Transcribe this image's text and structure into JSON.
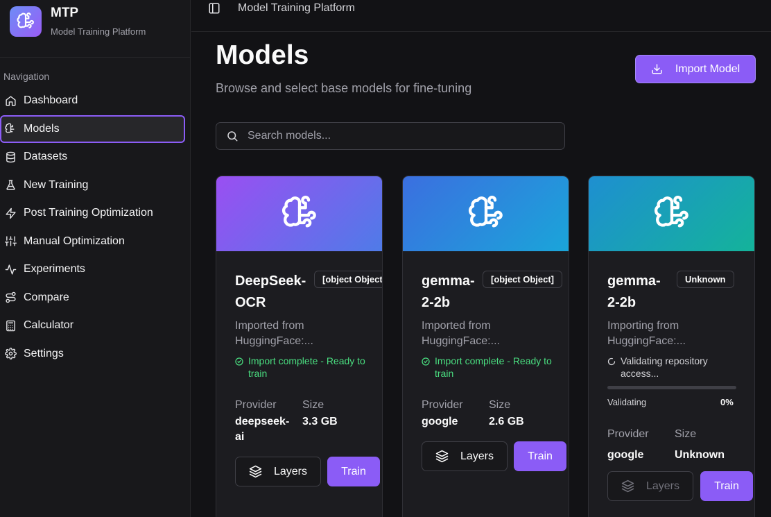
{
  "brand": {
    "name": "MTP",
    "subtitle": "Model Training Platform"
  },
  "sidebar": {
    "heading": "Navigation",
    "items": [
      {
        "label": "Dashboard",
        "icon": "home-icon"
      },
      {
        "label": "Models",
        "icon": "brain-icon",
        "active": true
      },
      {
        "label": "Datasets",
        "icon": "database-icon"
      },
      {
        "label": "New Training",
        "icon": "flask-icon"
      },
      {
        "label": "Post Training Optimization",
        "icon": "zap-icon"
      },
      {
        "label": "Manual Optimization",
        "icon": "sliders-icon"
      },
      {
        "label": "Experiments",
        "icon": "activity-icon"
      },
      {
        "label": "Compare",
        "icon": "route-icon"
      },
      {
        "label": "Calculator",
        "icon": "calculator-icon"
      },
      {
        "label": "Settings",
        "icon": "gear-icon"
      }
    ]
  },
  "topbar": {
    "title": "Model Training Platform"
  },
  "page": {
    "title": "Models",
    "subtitle": "Browse and select base models for fine-tuning",
    "import_label": "Import Model",
    "search_placeholder": "Search models..."
  },
  "colors": {
    "accent": "#8b5cf6",
    "success": "#4ade80",
    "background": "#121215"
  },
  "cards": [
    {
      "name": "DeepSeek-OCR",
      "badge": "[object Object]",
      "description": "Imported from HuggingFace:...",
      "status": "Import complete - Ready to train",
      "provider_label": "Provider",
      "provider": "deepseek-ai",
      "size_label": "Size",
      "size": "3.3 GB",
      "layers_label": "Layers",
      "train_label": "Train"
    },
    {
      "name": "gemma-2-2b",
      "badge": "[object Object]",
      "description": "Imported from HuggingFace:...",
      "status": "Import complete - Ready to train",
      "provider_label": "Provider",
      "provider": "google",
      "size_label": "Size",
      "size": "2.6 GB",
      "layers_label": "Layers",
      "train_label": "Train"
    },
    {
      "name": "gemma-2-2b",
      "badge": "Unknown",
      "description": "Importing from HuggingFace:...",
      "status": "Validating repository access...",
      "progress_label": "Validating",
      "progress_value": "0%",
      "progress": 0,
      "provider_label": "Provider",
      "provider": "google",
      "size_label": "Size",
      "size": "Unknown",
      "layers_label": "Layers",
      "train_label": "Train"
    }
  ]
}
